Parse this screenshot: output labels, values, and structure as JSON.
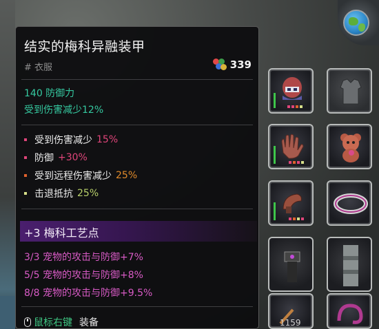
{
  "tooltip": {
    "title": "结实的梅科异融装甲",
    "category": "# 衣服",
    "price": "339",
    "stats_primary": [
      "140 防御力",
      "受到伤害减少12%"
    ],
    "bullets": [
      {
        "label": "受到伤害减少",
        "value": "15%",
        "dot_color": "#e0457a",
        "value_color": "#e0457a"
      },
      {
        "label": "防御",
        "value": "+30%",
        "dot_color": "#e0457a",
        "value_color": "#e0457a"
      },
      {
        "label": "受到远程伤害减少",
        "value": "25%",
        "dot_color": "#e0622d",
        "value_color": "#e08a2a"
      },
      {
        "label": "击退抵抗",
        "value": "25%",
        "dot_color": "#d7e08a",
        "value_color": "#b8d06a"
      }
    ],
    "section_header": "+3 梅科工艺点",
    "pet_bonuses": [
      "3/3 宠物的攻击与防御+7%",
      "5/5 宠物的攻击与防御+8%",
      "8/8 宠物的攻击与防御+9.5%"
    ],
    "footer": {
      "link": "鼠标右键",
      "action": "装备"
    }
  },
  "icons": {
    "globe": "globe-icon",
    "mouse": "mouse-right-click-icon",
    "currency": "gems-currency-icon"
  },
  "inventory": {
    "quantity_label": "1159"
  },
  "colors": {
    "stat_green": "#35c9a0",
    "pink": "#d95bc6",
    "footer_green": "#3fc884",
    "purple_band": "#4a1f6e"
  }
}
